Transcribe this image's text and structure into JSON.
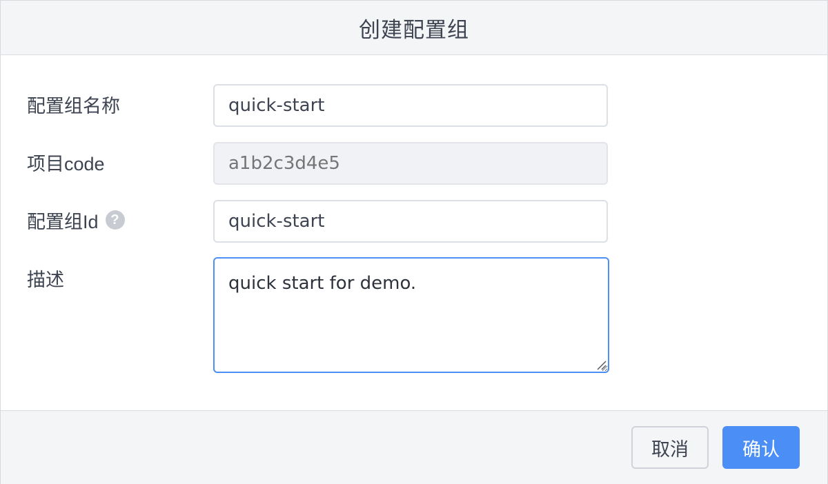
{
  "dialog": {
    "title": "创建配置组"
  },
  "form": {
    "group_name": {
      "label": "配置组名称",
      "value": "quick-start"
    },
    "project_code": {
      "label": "项目code",
      "placeholder": "a1b2c3d4e5"
    },
    "group_id": {
      "label": "配置组Id",
      "help_icon": "?",
      "value": "quick-start"
    },
    "description": {
      "label": "描述",
      "value": "quick start for demo."
    }
  },
  "footer": {
    "cancel_label": "取消",
    "confirm_label": "确认"
  },
  "colors": {
    "primary": "#4b8ef5",
    "border": "#dcdfe6",
    "header_bg": "#f4f5f7",
    "help_icon_bg": "#c8ccd2"
  }
}
